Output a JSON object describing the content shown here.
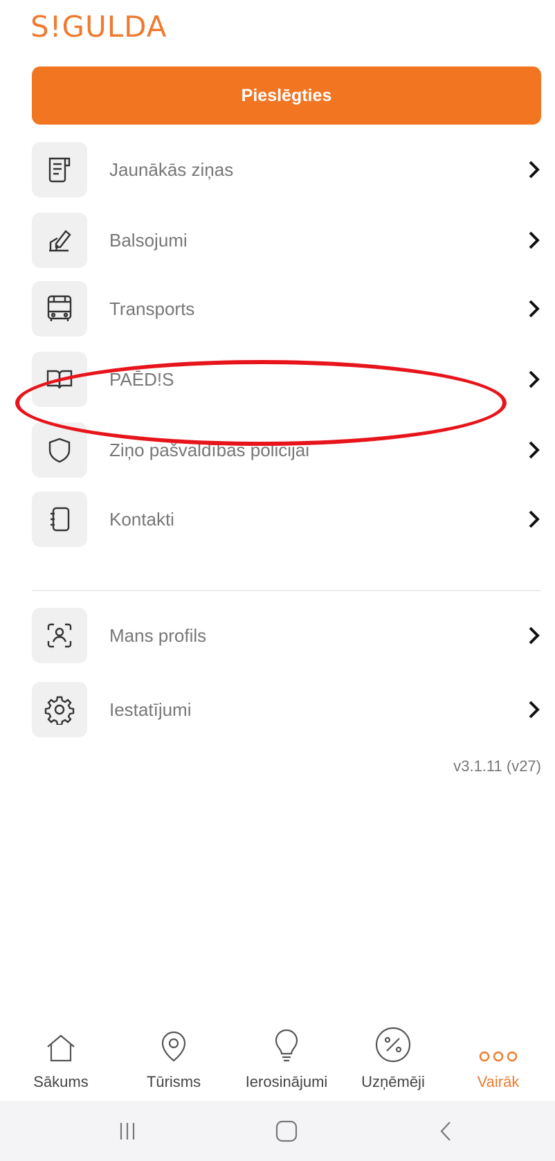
{
  "app": {
    "logo": "S!GULDA",
    "login_label": "Pieslēgties",
    "version": "v3.1.11 (v27)"
  },
  "menu": {
    "items": [
      {
        "label": "Jaunākās ziņas",
        "icon": "news-icon"
      },
      {
        "label": "Balsojumi",
        "icon": "vote-icon"
      },
      {
        "label": "Transports",
        "icon": "bus-icon"
      },
      {
        "label": "PAĒD!S",
        "icon": "book-icon"
      },
      {
        "label": "Ziņo pašvaldības policijai",
        "icon": "shield-icon"
      },
      {
        "label": "Kontakti",
        "icon": "contacts-icon"
      }
    ],
    "secondary": [
      {
        "label": "Mans profils",
        "icon": "profile-icon"
      },
      {
        "label": "Iestatījumi",
        "icon": "gear-icon"
      }
    ]
  },
  "tabbar": {
    "tabs": [
      {
        "label": "Sākums",
        "icon": "home-icon"
      },
      {
        "label": "Tūrisms",
        "icon": "location-icon"
      },
      {
        "label": "Ierosinājumi",
        "icon": "lightbulb-icon"
      },
      {
        "label": "Uzņēmēji",
        "icon": "percent-icon"
      },
      {
        "label": "Vairāk",
        "icon": "more-icon",
        "active": true
      }
    ]
  },
  "colors": {
    "accent": "#f27522",
    "highlight": "#e8141c"
  }
}
